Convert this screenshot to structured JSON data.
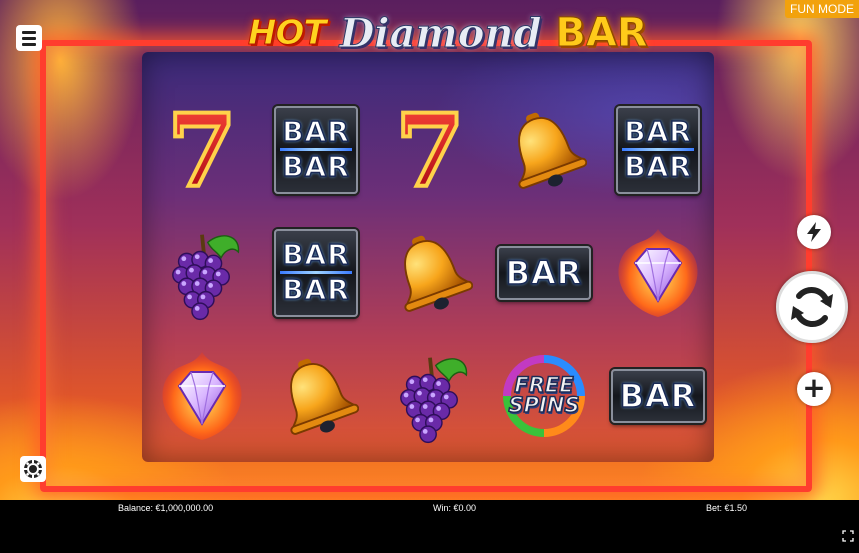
{
  "game": {
    "logo": {
      "hot": "HOT",
      "diamond": "Diamond",
      "bar": "BAR"
    },
    "mode_badge": "FUN MODE"
  },
  "reels": {
    "columns": 5,
    "rows": 3,
    "symbols": [
      [
        "seven",
        "double-bar",
        "seven",
        "bell",
        "double-bar"
      ],
      [
        "grapes",
        "double-bar",
        "bell",
        "single-bar",
        "fire-diamond"
      ],
      [
        "fire-diamond",
        "bell",
        "grapes",
        "free-spins",
        "single-bar"
      ]
    ],
    "bar_label": "BAR",
    "seven_label": "7",
    "free_spins_line1": "FREE",
    "free_spins_line2": "SPINS"
  },
  "controls": {
    "menu_icon": "hamburger-menu-icon",
    "chip_icon": "casino-chip-icon",
    "turbo_icon": "lightning-bolt-icon",
    "spin_icon": "spin-arrows-icon",
    "plus_label": "+",
    "fullscreen_icon": "fullscreen-icon"
  },
  "status": {
    "balance": "Balance: €1,000,000.00",
    "win": "Win: €0.00",
    "bet": "Bet: €1.50"
  },
  "colors": {
    "mode_badge": "#f2a20d",
    "frame": "#ff3d2e",
    "logo_gold": "#ffd21f"
  }
}
